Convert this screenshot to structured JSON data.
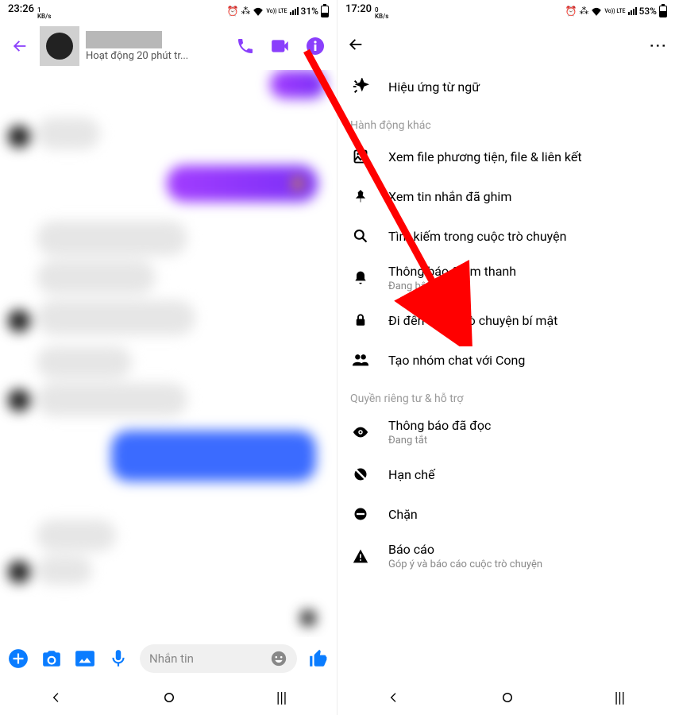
{
  "left": {
    "status": {
      "time": "23:26",
      "rate": "1",
      "rate_unit": "KB/s",
      "pct": "31%",
      "volte": "Vo)) LTE"
    },
    "header": {
      "subtitle": "Hoạt động 20 phút tr..."
    },
    "input": {
      "placeholder": "Nhắn tin"
    }
  },
  "right": {
    "status": {
      "time": "17:20",
      "rate": "0",
      "rate_unit": "KB/s",
      "pct": "53%",
      "volte": "Vo)) LTE"
    },
    "sections": {
      "first_row": "Hiệu ứng từ ngữ",
      "other_actions_title": "Hành động khác",
      "privacy_title": "Quyền riêng tư & hỗ trợ"
    },
    "rows": {
      "media": "Xem file phương tiện, file & liên kết",
      "pinned": "Xem tin nhắn đã ghim",
      "search": "Tìm kiếm trong cuộc trò chuyện",
      "notif": "Thông báo & âm thanh",
      "notif_sub": "Đang bật",
      "secret": "Đi đến Cuộc trò chuyện bí mật",
      "group": "Tạo nhóm chat với Cong",
      "read": "Thông báo đã đọc",
      "read_sub": "Đang tắt",
      "restrict": "Hạn chế",
      "block": "Chặn",
      "report": "Báo cáo",
      "report_sub": "Góp ý và báo cáo cuộc trò chuyện"
    }
  }
}
